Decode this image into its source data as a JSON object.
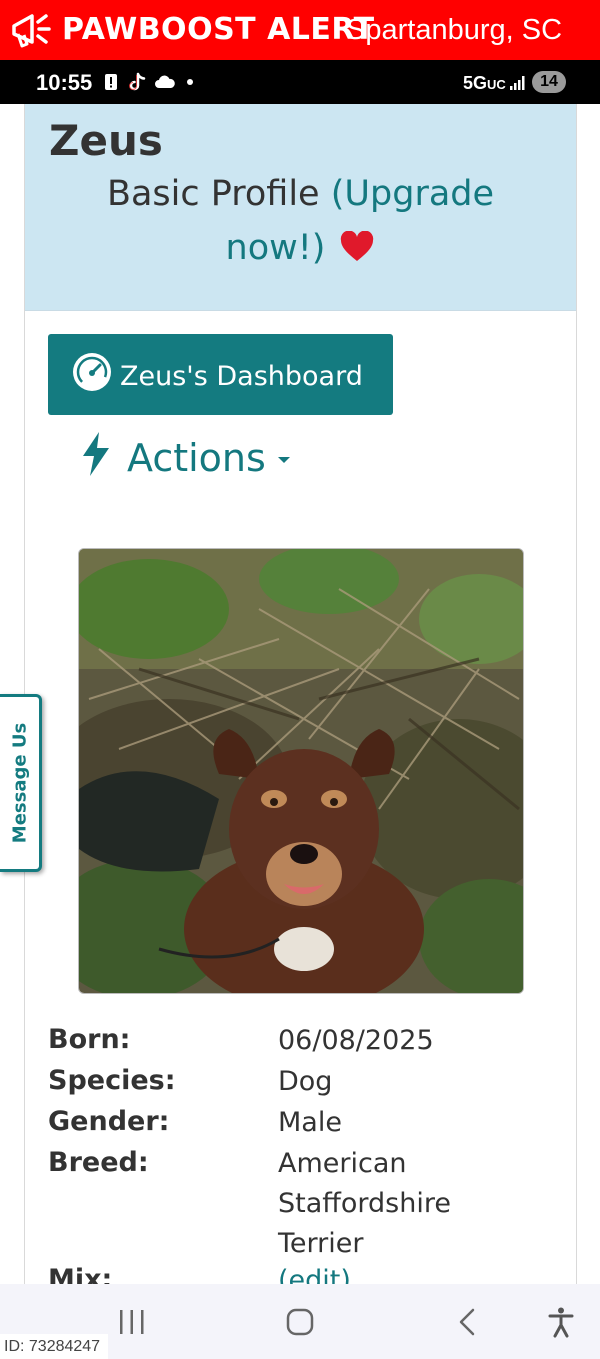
{
  "alert_bar": {
    "brand": "PAWBOOST ALERT",
    "location": "Spartanburg, SC",
    "icon": "megaphone-icon",
    "color": "#ff0000"
  },
  "status_bar": {
    "time": "10:55",
    "network": "5G",
    "network_suffix": "UC",
    "notification_count": "14",
    "icons": [
      "alert-icon",
      "tiktok-icon",
      "cloud-icon",
      "dot-icon",
      "signal-icon"
    ]
  },
  "profile": {
    "name": "Zeus",
    "plan": "Basic Profile",
    "upgrade_open": "(Upgrade",
    "upgrade_close": "now!)",
    "header_color": "#cce6f2",
    "accent_color": "#147b80"
  },
  "dashboard_button": {
    "label": "Zeus's Dashboard",
    "icon": "gauge-icon"
  },
  "actions_menu": {
    "label": "Actions",
    "icon": "bolt-icon"
  },
  "details": [
    {
      "label": "Born:",
      "value": "06/08/2025"
    },
    {
      "label": "Species:",
      "value": "Dog"
    },
    {
      "label": "Gender:",
      "value": "Male"
    },
    {
      "label": "Breed:",
      "value": "American Staffordshire Terrier"
    },
    {
      "label": "Mix:",
      "value": "(edit)"
    }
  ],
  "message_tab": {
    "label": "Message Us"
  },
  "image_id": "ID: 73284247"
}
